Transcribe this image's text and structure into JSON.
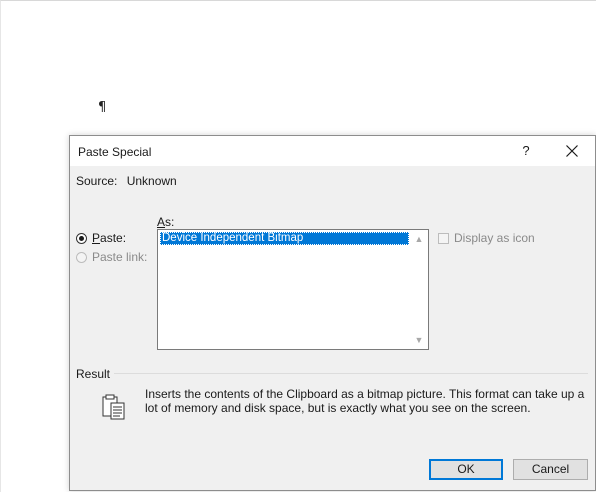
{
  "document": {
    "paragraph_mark": "¶"
  },
  "dialog": {
    "title": "Paste Special",
    "help_label": "?",
    "source_label": "Source:",
    "source_value": "Unknown",
    "as_label": "As:",
    "options": [
      {
        "label": "Paste:",
        "checked": true,
        "enabled": true
      },
      {
        "label": "Paste link:",
        "checked": false,
        "enabled": false
      }
    ],
    "formats": [
      "Device Independent Bitmap"
    ],
    "selected_format": "Device Independent Bitmap",
    "display_as_icon": {
      "label": "Display as icon",
      "checked": false,
      "enabled": false
    },
    "result_label": "Result",
    "result_text": "Inserts the contents of the Clipboard as a bitmap picture. This format can take up a lot of memory and disk space, but is exactly what you see on the screen.",
    "ok_label": "OK",
    "cancel_label": "Cancel"
  },
  "colors": {
    "accent": "#0078d7",
    "dialog_bg": "#f0f0f0"
  }
}
